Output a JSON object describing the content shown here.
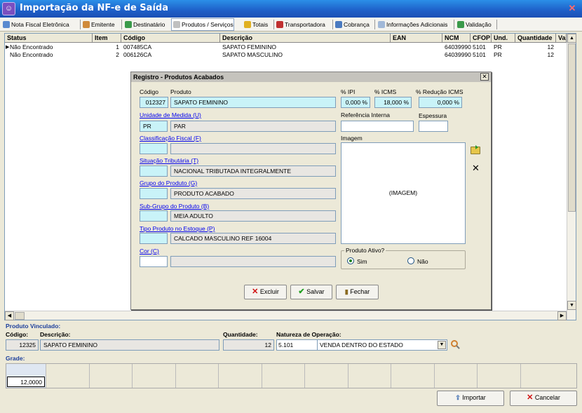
{
  "window": {
    "title": "Importação da NF-e de Saída",
    "icon": "app-icon",
    "close_icon": "close-icon"
  },
  "tabs": [
    {
      "label": "Nota Fiscal Eletrônica",
      "icon": "document-icon"
    },
    {
      "label": "Emitente",
      "icon": "person-icon"
    },
    {
      "label": "Destinatário",
      "icon": "person-icon"
    },
    {
      "label": "Produtos / Serviços",
      "icon": "products-icon",
      "active": true
    },
    {
      "label": "Totais",
      "icon": "coins-icon"
    },
    {
      "label": "Transportadora",
      "icon": "truck-icon"
    },
    {
      "label": "Cobrança",
      "icon": "pen-icon"
    },
    {
      "label": "Informações Adicionais",
      "icon": "page-icon"
    },
    {
      "label": "Validação",
      "icon": "check-icon"
    }
  ],
  "grid": {
    "columns": [
      "Status",
      "Item",
      "Código",
      "Descrição",
      "EAN",
      "NCM",
      "CFOP",
      "Und.",
      "Quantidade",
      "Val"
    ],
    "rows": [
      {
        "status": "Não Encontrado",
        "item": "1",
        "codigo": "007485CA",
        "descricao": "SAPATO FEMININO",
        "ean": "",
        "ncm": "64039990",
        "cfop": "5101",
        "und": "PR",
        "quantidade": "12"
      },
      {
        "status": "Não Encontrado",
        "item": "2",
        "codigo": "006126CA",
        "descricao": "SAPATO MASCULINO",
        "ean": "",
        "ncm": "64039990",
        "cfop": "5101",
        "und": "PR",
        "quantidade": "12"
      }
    ]
  },
  "dialog": {
    "title": "Registro - Produtos Acabados",
    "codigo_label": "Código",
    "codigo": "012327",
    "produto_label": "Produto",
    "produto": "SAPATO FEMININO",
    "ipi_label": "% IPI",
    "ipi": "0,000 %",
    "icms_label": "% ICMS",
    "icms": "18,000 %",
    "reducao_label": "% Redução ICMS",
    "reducao": "0,000 %",
    "unidade_label": "Unidade de Medida (U)",
    "unidade_code": "PR",
    "unidade_desc": "PAR",
    "referencia_label": "Referência Interna",
    "referencia": "",
    "espessura_label": "Espessura",
    "espessura": "",
    "classificacao_label": "Classificação Fiscal (F)",
    "classificacao_code": "",
    "classificacao_desc": "",
    "imagem_label": "Imagem",
    "imagem_placeholder": "(IMAGEM)",
    "situacao_label": "Situação Tributária (T)",
    "situacao_code": "",
    "situacao_desc": "NACIONAL TRIBUTADA INTEGRALMENTE",
    "grupo_label": "Grupo do Produto (G)",
    "grupo_code": "",
    "grupo_desc": "PRODUTO ACABADO",
    "subgrupo_label": "Sub-Grupo do Produto (B)",
    "subgrupo_code": "",
    "subgrupo_desc": "MEIA ADULTO",
    "tipo_label": "Tipo Produto no Estoque (P)",
    "tipo_code": "",
    "tipo_desc": "CALCADO MASCULINO REF  16004",
    "cor_label": "Cor (C)",
    "cor_code": "",
    "cor_desc": "",
    "ativo_label": "Produto Ativo?",
    "sim_label": "Sim",
    "nao_label": "Não",
    "ativo": "Sim",
    "excluir_label": "Excluir",
    "salvar_label": "Salvar",
    "fechar_label": "Fechar"
  },
  "vinculado": {
    "title": "Produto Vinculado:",
    "codigo_label": "Código:",
    "descricao_label": "Descrição:",
    "quantidade_label": "Quantidade:",
    "natureza_label": "Natureza de Operação:",
    "codigo": "12325",
    "descricao": "SAPATO FEMININO",
    "quantidade": "12",
    "natureza_code": "5.101",
    "natureza_desc": "VENDA DENTRO DO ESTADO"
  },
  "grade": {
    "label": "Grade:",
    "value": "12,0000"
  },
  "footer": {
    "importar_label": "Importar",
    "cancelar_label": "Cancelar"
  }
}
